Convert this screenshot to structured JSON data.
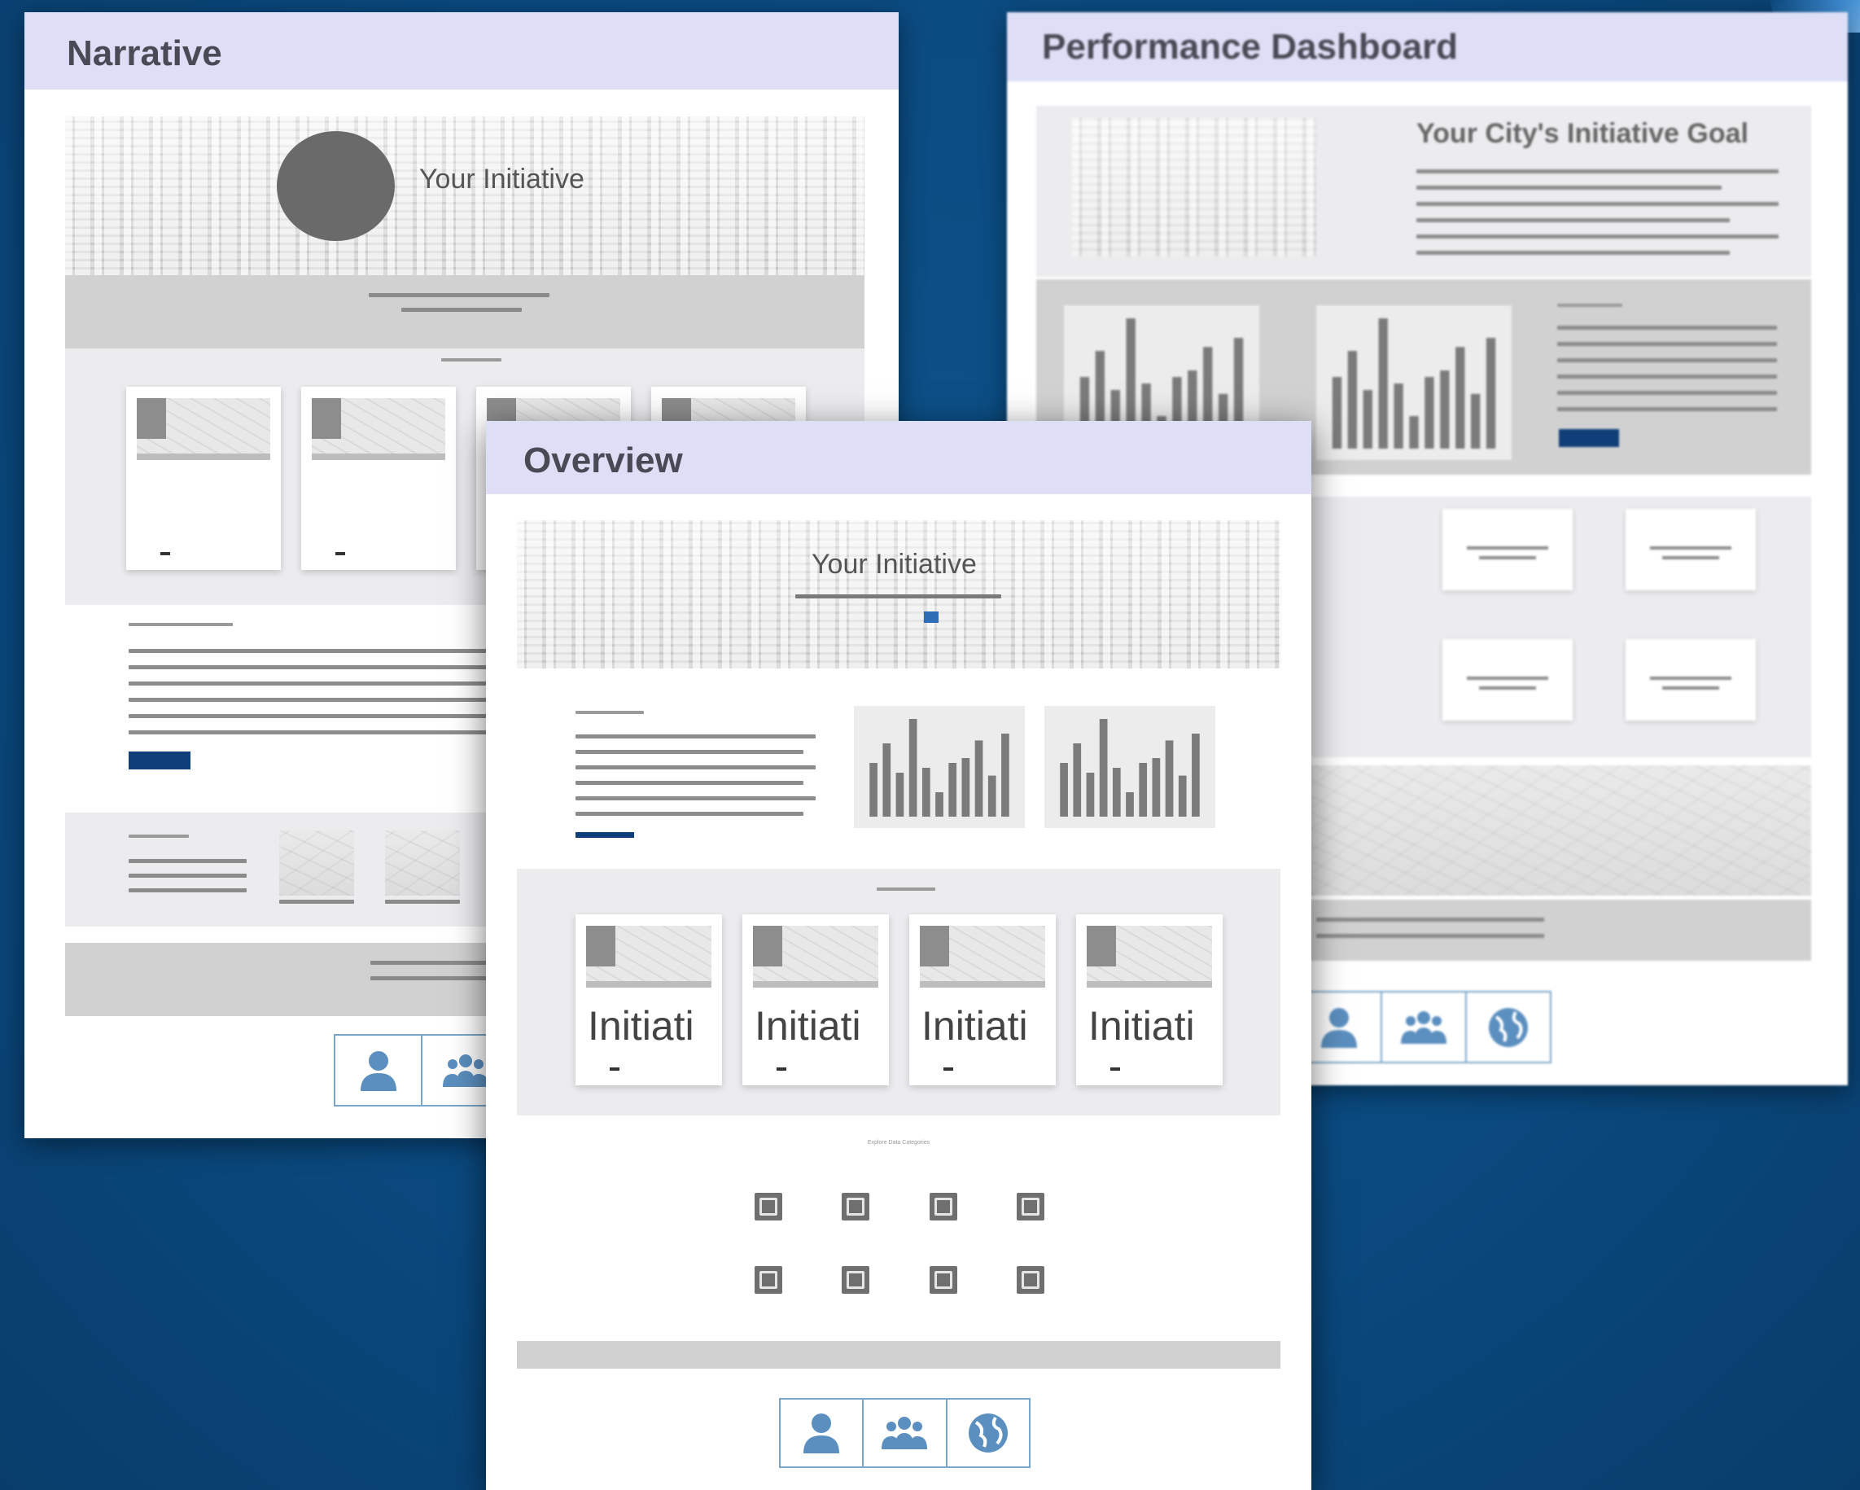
{
  "panels": {
    "narrative": {
      "title": "Narrative",
      "hero_title": "Your Initiative",
      "card_count": 4
    },
    "dashboard": {
      "title": "Performance Dashboard",
      "goal_title": "Your City's Initiative Goal"
    },
    "overview": {
      "title": "Overview",
      "hero_title": "Your Initiative",
      "cards": [
        {
          "label": "Initiati"
        },
        {
          "label": "Initiati"
        },
        {
          "label": "Initiati"
        },
        {
          "label": "Initiati"
        }
      ],
      "categories_heading": "Explore Data Categories",
      "categories": [
        {
          "icon": "chart-icon"
        },
        {
          "icon": "document-icon"
        },
        {
          "icon": "building-icon"
        },
        {
          "icon": "image-icon"
        },
        {
          "icon": "person-badge-icon"
        },
        {
          "icon": "heart-shield-icon"
        },
        {
          "icon": "phone-icon"
        },
        {
          "icon": "gallery-icon"
        }
      ],
      "footer_icons": [
        "person-icon",
        "people-group-icon",
        "globe-icon"
      ]
    }
  },
  "colors": {
    "background": "#0a4a80",
    "header": "#dedff6",
    "accent": "#0f3e78",
    "icon_blue": "#5b8fbf"
  }
}
